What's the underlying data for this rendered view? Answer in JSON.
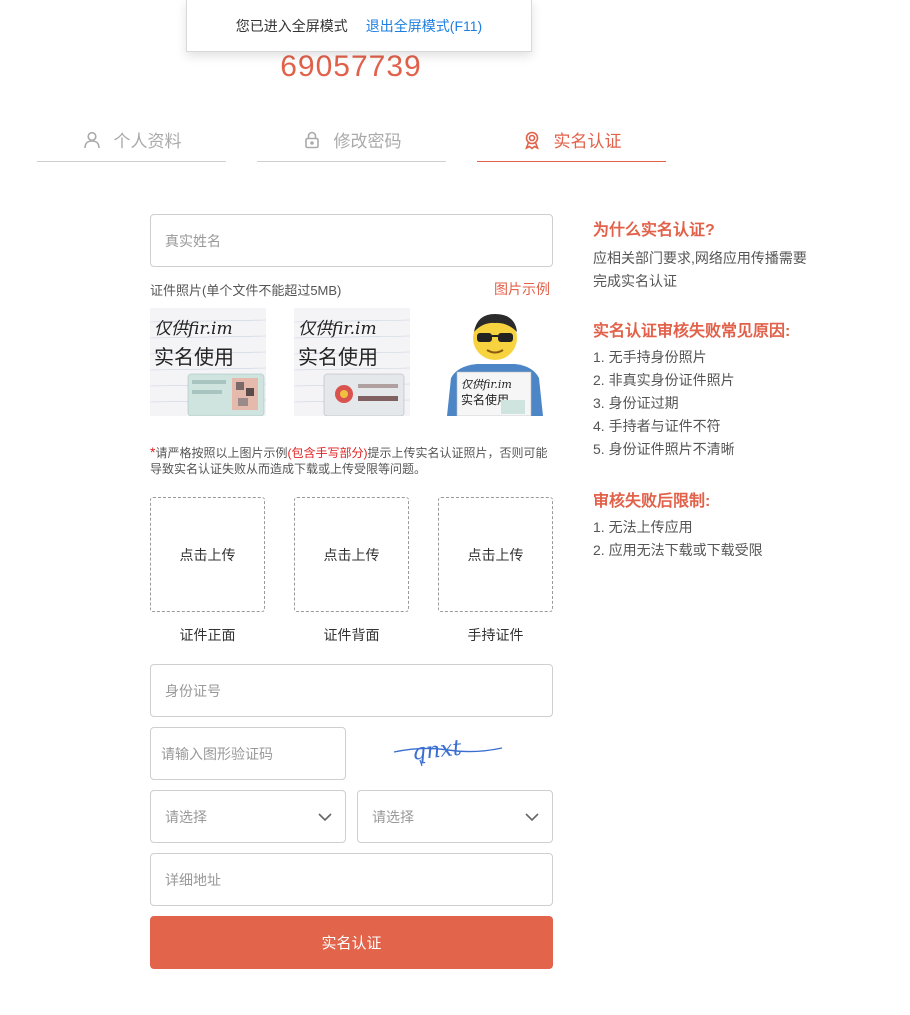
{
  "fullscreen": {
    "message": "您已进入全屏模式",
    "exit_label": "退出全屏模式(F11)"
  },
  "user_id": "69057739",
  "tabs": [
    {
      "label": "个人资料",
      "icon": "user-icon"
    },
    {
      "label": "修改密码",
      "icon": "lock-icon"
    },
    {
      "label": "实名认证",
      "icon": "badge-icon",
      "active": true
    }
  ],
  "form": {
    "name_placeholder": "真实姓名",
    "photo_label": "证件照片(单个文件不能超过5MB)",
    "sample_link": "图片示例",
    "sample_text_line1": "仅供fir.im",
    "sample_text_line2": "实名使用",
    "warning_star": "*",
    "warning_before": "请严格按照以上图片示例",
    "warning_highlight": "(包含手写部分)",
    "warning_after": "提示上传实名认证照片，否则可能导致实名认证失败从而造成下载或上传受限等问题。",
    "uploads": [
      {
        "button": "点击上传",
        "caption": "证件正面"
      },
      {
        "button": "点击上传",
        "caption": "证件背面"
      },
      {
        "button": "点击上传",
        "caption": "手持证件"
      }
    ],
    "id_placeholder": "身份证号",
    "captcha_placeholder": "请输入图形验证码",
    "captcha_text": "qnxt",
    "select1": "请选择",
    "select2": "请选择",
    "address_placeholder": "详细地址",
    "submit_label": "实名认证"
  },
  "side": {
    "why_title": "为什么实名认证?",
    "why_text": "应相关部门要求,网络应用传播需要完成实名认证",
    "fail_title": "实名认证审核失败常见原因:",
    "fail_items": [
      "1. 无手持身份照片",
      "2. 非真实身份证件照片",
      "3. 身份证过期",
      "4. 手持者与证件不符",
      "5. 身份证件照片不清晰"
    ],
    "limit_title": "审核失败后限制:",
    "limit_items": [
      "1. 无法上传应用",
      "2. 应用无法下载或下载受限"
    ]
  },
  "colors": {
    "accent": "#e2614a",
    "link": "#1f7fe0",
    "warning": "#e02020"
  }
}
